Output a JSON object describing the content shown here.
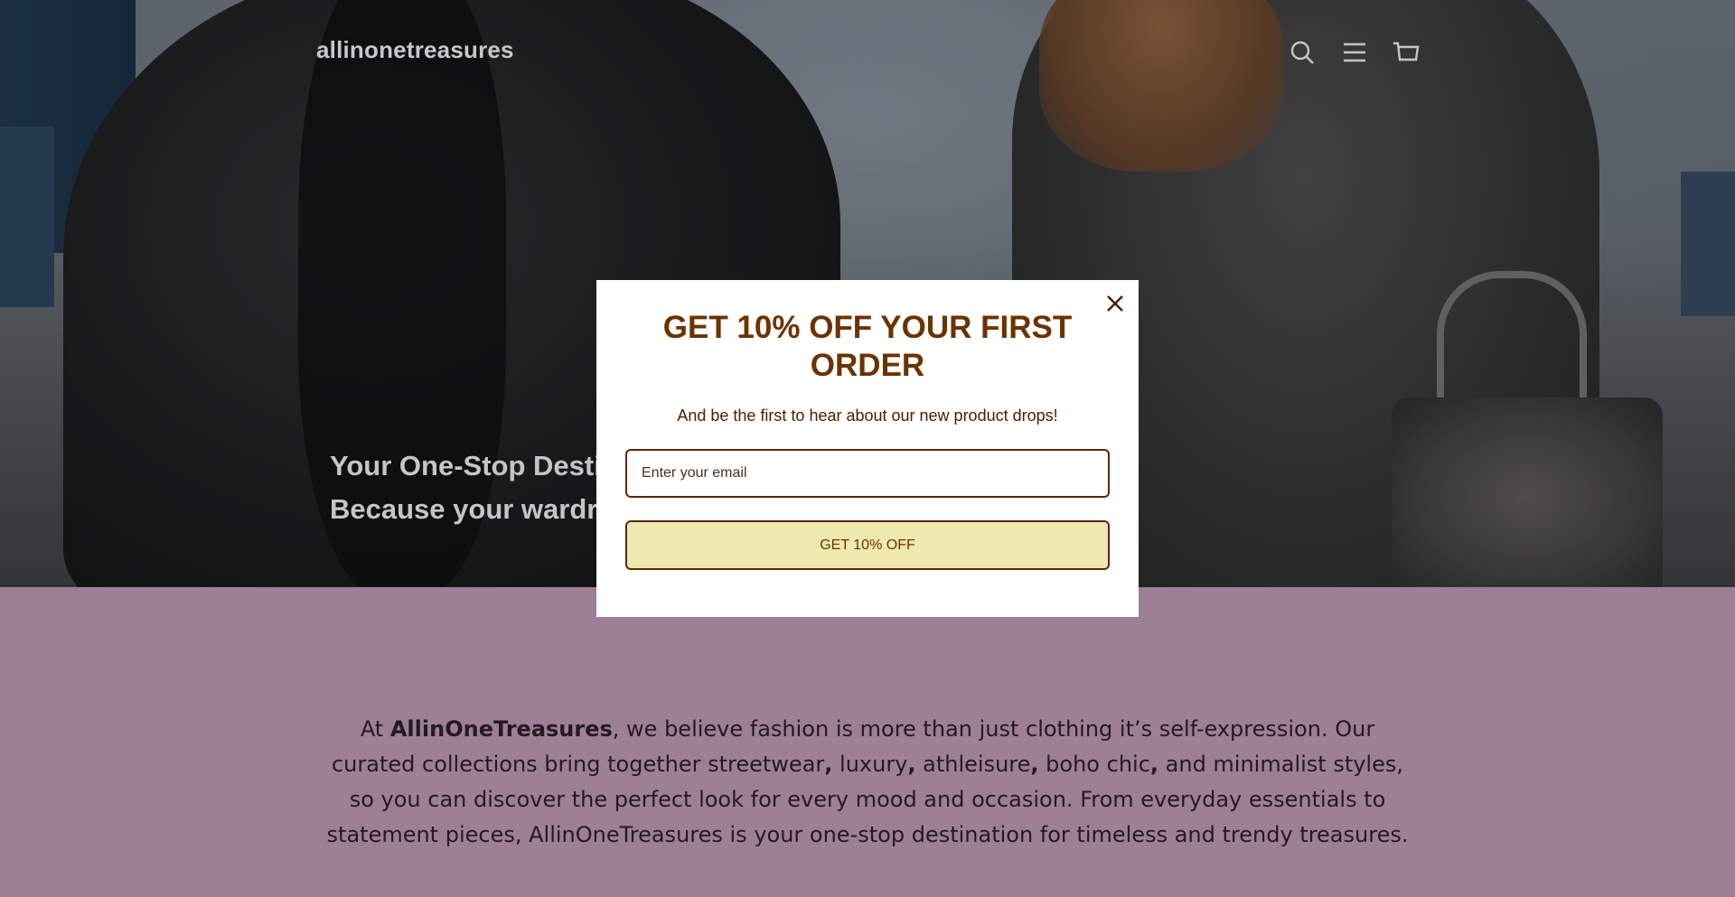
{
  "header": {
    "logo": "allinonetreasures",
    "icons": [
      "search-icon",
      "menu-icon",
      "cart-icon"
    ]
  },
  "hero": {
    "line1": "Your One-Stop Destination for Every Style.",
    "line2": "Because your wardrobe deserves it all."
  },
  "about": {
    "prefix": "At ",
    "brand": "AllinOneTreasures",
    "part1": ", we believe fashion is more than just clothing it’s self-expression. Our curated collections bring together streetwear",
    "sep1": ",",
    "t2": " luxury",
    "sep2": ",",
    "t3": " athleisure",
    "sep3": ",",
    "t4": " boho chic",
    "sep4": ",",
    "part5": " and minimalist styles, so you can discover the perfect look for every mood and occasion. From everyday essentials to statement pieces, AllinOneTreasures is your one-stop destination for timeless and trendy treasures."
  },
  "popup": {
    "title": "GET 10% OFF YOUR FIRST ORDER",
    "subtitle": "And be the first to hear about our new product drops!",
    "email_placeholder": "Enter your email",
    "email_value": "",
    "button_label": "GET 10% OFF",
    "close_icon": "close-icon"
  },
  "colors": {
    "popup_title": "#6b3300",
    "button_bg": "#eee9ae",
    "button_border": "#5a2a00",
    "about_bg": "#9d8096"
  }
}
